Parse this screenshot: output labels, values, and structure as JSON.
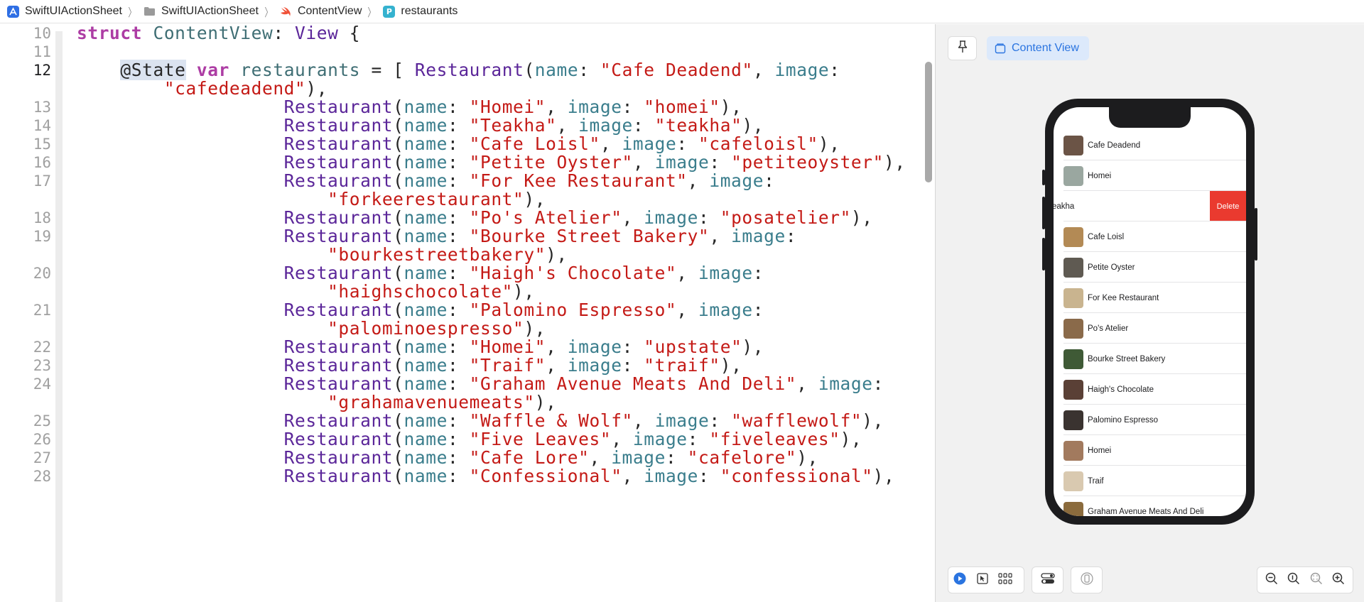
{
  "breadcrumb": [
    {
      "label": "SwiftUIActionSheet",
      "icon": "xcode-project-icon"
    },
    {
      "label": "SwiftUIActionSheet",
      "icon": "folder-icon"
    },
    {
      "label": "ContentView",
      "icon": "swift-file-icon"
    },
    {
      "label": "restaurants",
      "icon": "property-icon"
    }
  ],
  "property_badge": "P",
  "code_lines": [
    {
      "n": "10",
      "html_key": 0
    },
    {
      "n": "11",
      "html_key": 1
    },
    {
      "n": "12",
      "html_key": 2
    },
    {
      "n": "",
      "html_key": 3
    },
    {
      "n": "13",
      "html_key": 4
    },
    {
      "n": "14",
      "html_key": 5
    },
    {
      "n": "15",
      "html_key": 6
    },
    {
      "n": "16",
      "html_key": 7
    },
    {
      "n": "17",
      "html_key": 8
    },
    {
      "n": "",
      "html_key": 9
    },
    {
      "n": "18",
      "html_key": 10
    },
    {
      "n": "19",
      "html_key": 11
    },
    {
      "n": "",
      "html_key": 12
    },
    {
      "n": "20",
      "html_key": 13
    },
    {
      "n": "",
      "html_key": 14
    },
    {
      "n": "21",
      "html_key": 15
    },
    {
      "n": "",
      "html_key": 16
    },
    {
      "n": "22",
      "html_key": 17
    },
    {
      "n": "23",
      "html_key": 18
    },
    {
      "n": "24",
      "html_key": 19
    },
    {
      "n": "",
      "html_key": 20
    },
    {
      "n": "25",
      "html_key": 21
    },
    {
      "n": "26",
      "html_key": 22
    },
    {
      "n": "27",
      "html_key": 23
    },
    {
      "n": "28",
      "html_key": 24
    }
  ],
  "tokens": [
    [
      [
        "kw",
        "struct"
      ],
      [
        "p",
        " "
      ],
      [
        "ty2",
        "ContentView"
      ],
      [
        "p",
        ": "
      ],
      [
        "ty",
        "View"
      ],
      [
        "p",
        " {"
      ]
    ],
    [],
    [
      [
        "p",
        "    "
      ],
      [
        "hl",
        "@State"
      ],
      [
        "p",
        " "
      ],
      [
        "kw",
        "var"
      ],
      [
        "p",
        " "
      ],
      [
        "ty2",
        "restaurants"
      ],
      [
        "p",
        " = [ "
      ],
      [
        "ty",
        "Restaurant"
      ],
      [
        "p",
        "("
      ],
      [
        "param",
        "name"
      ],
      [
        "p",
        ": "
      ],
      [
        "str",
        "\"Cafe Deadend\""
      ],
      [
        "p",
        ", "
      ],
      [
        "param",
        "image"
      ],
      [
        "p",
        ":"
      ]
    ],
    [
      [
        "p",
        "        "
      ],
      [
        "str",
        "\"cafedeadend\""
      ],
      [
        "p",
        "),"
      ]
    ],
    [
      [
        "p",
        "                   "
      ],
      [
        "ty",
        "Restaurant"
      ],
      [
        "p",
        "("
      ],
      [
        "param",
        "name"
      ],
      [
        "p",
        ": "
      ],
      [
        "str",
        "\"Homei\""
      ],
      [
        "p",
        ", "
      ],
      [
        "param",
        "image"
      ],
      [
        "p",
        ": "
      ],
      [
        "str",
        "\"homei\""
      ],
      [
        "p",
        "),"
      ]
    ],
    [
      [
        "p",
        "                   "
      ],
      [
        "ty",
        "Restaurant"
      ],
      [
        "p",
        "("
      ],
      [
        "param",
        "name"
      ],
      [
        "p",
        ": "
      ],
      [
        "str",
        "\"Teakha\""
      ],
      [
        "p",
        ", "
      ],
      [
        "param",
        "image"
      ],
      [
        "p",
        ": "
      ],
      [
        "str",
        "\"teakha\""
      ],
      [
        "p",
        "),"
      ]
    ],
    [
      [
        "p",
        "                   "
      ],
      [
        "ty",
        "Restaurant"
      ],
      [
        "p",
        "("
      ],
      [
        "param",
        "name"
      ],
      [
        "p",
        ": "
      ],
      [
        "str",
        "\"Cafe Loisl\""
      ],
      [
        "p",
        ", "
      ],
      [
        "param",
        "image"
      ],
      [
        "p",
        ": "
      ],
      [
        "str",
        "\"cafeloisl\""
      ],
      [
        "p",
        "),"
      ]
    ],
    [
      [
        "p",
        "                   "
      ],
      [
        "ty",
        "Restaurant"
      ],
      [
        "p",
        "("
      ],
      [
        "param",
        "name"
      ],
      [
        "p",
        ": "
      ],
      [
        "str",
        "\"Petite Oyster\""
      ],
      [
        "p",
        ", "
      ],
      [
        "param",
        "image"
      ],
      [
        "p",
        ": "
      ],
      [
        "str",
        "\"petiteoyster\""
      ],
      [
        "p",
        "),"
      ]
    ],
    [
      [
        "p",
        "                   "
      ],
      [
        "ty",
        "Restaurant"
      ],
      [
        "p",
        "("
      ],
      [
        "param",
        "name"
      ],
      [
        "p",
        ": "
      ],
      [
        "str",
        "\"For Kee Restaurant\""
      ],
      [
        "p",
        ", "
      ],
      [
        "param",
        "image"
      ],
      [
        "p",
        ":"
      ]
    ],
    [
      [
        "p",
        "                       "
      ],
      [
        "str",
        "\"forkeerestaurant\""
      ],
      [
        "p",
        "),"
      ]
    ],
    [
      [
        "p",
        "                   "
      ],
      [
        "ty",
        "Restaurant"
      ],
      [
        "p",
        "("
      ],
      [
        "param",
        "name"
      ],
      [
        "p",
        ": "
      ],
      [
        "str",
        "\"Po's Atelier\""
      ],
      [
        "p",
        ", "
      ],
      [
        "param",
        "image"
      ],
      [
        "p",
        ": "
      ],
      [
        "str",
        "\"posatelier\""
      ],
      [
        "p",
        "),"
      ]
    ],
    [
      [
        "p",
        "                   "
      ],
      [
        "ty",
        "Restaurant"
      ],
      [
        "p",
        "("
      ],
      [
        "param",
        "name"
      ],
      [
        "p",
        ": "
      ],
      [
        "str",
        "\"Bourke Street Bakery\""
      ],
      [
        "p",
        ", "
      ],
      [
        "param",
        "image"
      ],
      [
        "p",
        ":"
      ]
    ],
    [
      [
        "p",
        "                       "
      ],
      [
        "str",
        "\"bourkestreetbakery\""
      ],
      [
        "p",
        "),"
      ]
    ],
    [
      [
        "p",
        "                   "
      ],
      [
        "ty",
        "Restaurant"
      ],
      [
        "p",
        "("
      ],
      [
        "param",
        "name"
      ],
      [
        "p",
        ": "
      ],
      [
        "str",
        "\"Haigh's Chocolate\""
      ],
      [
        "p",
        ", "
      ],
      [
        "param",
        "image"
      ],
      [
        "p",
        ":"
      ]
    ],
    [
      [
        "p",
        "                       "
      ],
      [
        "str",
        "\"haighschocolate\""
      ],
      [
        "p",
        "),"
      ]
    ],
    [
      [
        "p",
        "                   "
      ],
      [
        "ty",
        "Restaurant"
      ],
      [
        "p",
        "("
      ],
      [
        "param",
        "name"
      ],
      [
        "p",
        ": "
      ],
      [
        "str",
        "\"Palomino Espresso\""
      ],
      [
        "p",
        ", "
      ],
      [
        "param",
        "image"
      ],
      [
        "p",
        ":"
      ]
    ],
    [
      [
        "p",
        "                       "
      ],
      [
        "str",
        "\"palominoespresso\""
      ],
      [
        "p",
        "),"
      ]
    ],
    [
      [
        "p",
        "                   "
      ],
      [
        "ty",
        "Restaurant"
      ],
      [
        "p",
        "("
      ],
      [
        "param",
        "name"
      ],
      [
        "p",
        ": "
      ],
      [
        "str",
        "\"Homei\""
      ],
      [
        "p",
        ", "
      ],
      [
        "param",
        "image"
      ],
      [
        "p",
        ": "
      ],
      [
        "str",
        "\"upstate\""
      ],
      [
        "p",
        "),"
      ]
    ],
    [
      [
        "p",
        "                   "
      ],
      [
        "ty",
        "Restaurant"
      ],
      [
        "p",
        "("
      ],
      [
        "param",
        "name"
      ],
      [
        "p",
        ": "
      ],
      [
        "str",
        "\"Traif\""
      ],
      [
        "p",
        ", "
      ],
      [
        "param",
        "image"
      ],
      [
        "p",
        ": "
      ],
      [
        "str",
        "\"traif\""
      ],
      [
        "p",
        "),"
      ]
    ],
    [
      [
        "p",
        "                   "
      ],
      [
        "ty",
        "Restaurant"
      ],
      [
        "p",
        "("
      ],
      [
        "param",
        "name"
      ],
      [
        "p",
        ": "
      ],
      [
        "str",
        "\"Graham Avenue Meats And Deli\""
      ],
      [
        "p",
        ", "
      ],
      [
        "param",
        "image"
      ],
      [
        "p",
        ":"
      ]
    ],
    [
      [
        "p",
        "                       "
      ],
      [
        "str",
        "\"grahamavenuemeats\""
      ],
      [
        "p",
        "),"
      ]
    ],
    [
      [
        "p",
        "                   "
      ],
      [
        "ty",
        "Restaurant"
      ],
      [
        "p",
        "("
      ],
      [
        "param",
        "name"
      ],
      [
        "p",
        ": "
      ],
      [
        "str",
        "\"Waffle & Wolf\""
      ],
      [
        "p",
        ", "
      ],
      [
        "param",
        "image"
      ],
      [
        "p",
        ": "
      ],
      [
        "str",
        "\"wafflewolf\""
      ],
      [
        "p",
        "),"
      ]
    ],
    [
      [
        "p",
        "                   "
      ],
      [
        "ty",
        "Restaurant"
      ],
      [
        "p",
        "("
      ],
      [
        "param",
        "name"
      ],
      [
        "p",
        ": "
      ],
      [
        "str",
        "\"Five Leaves\""
      ],
      [
        "p",
        ", "
      ],
      [
        "param",
        "image"
      ],
      [
        "p",
        ": "
      ],
      [
        "str",
        "\"fiveleaves\""
      ],
      [
        "p",
        "),"
      ]
    ],
    [
      [
        "p",
        "                   "
      ],
      [
        "ty",
        "Restaurant"
      ],
      [
        "p",
        "("
      ],
      [
        "param",
        "name"
      ],
      [
        "p",
        ": "
      ],
      [
        "str",
        "\"Cafe Lore\""
      ],
      [
        "p",
        ", "
      ],
      [
        "param",
        "image"
      ],
      [
        "p",
        ": "
      ],
      [
        "str",
        "\"cafelore\""
      ],
      [
        "p",
        "),"
      ]
    ],
    [
      [
        "p",
        "                   "
      ],
      [
        "ty",
        "Restaurant"
      ],
      [
        "p",
        "("
      ],
      [
        "param",
        "name"
      ],
      [
        "p",
        ": "
      ],
      [
        "str",
        "\"Confessional\""
      ],
      [
        "p",
        ", "
      ],
      [
        "param",
        "image"
      ],
      [
        "p",
        ": "
      ],
      [
        "str",
        "\"confessional\""
      ],
      [
        "p",
        "),"
      ]
    ]
  ],
  "current_line": "12",
  "preview": {
    "content_view_label": "Content View",
    "delete_label": "Delete",
    "swiped_row_label": "eakha",
    "rows": [
      {
        "name": "Cafe Deadend",
        "color": "#6b5446"
      },
      {
        "name": "Homei",
        "color": "#9aa7a0"
      },
      {
        "name": "eakha",
        "swiped": true
      },
      {
        "name": "Cafe Loisl",
        "color": "#b38a55"
      },
      {
        "name": "Petite Oyster",
        "color": "#5f5a52"
      },
      {
        "name": "For Kee Restaurant",
        "color": "#c9b48f"
      },
      {
        "name": "Po's Atelier",
        "color": "#8a6a4a"
      },
      {
        "name": "Bourke Street Bakery",
        "color": "#3f5a36"
      },
      {
        "name": "Haigh's Chocolate",
        "color": "#5a4036"
      },
      {
        "name": "Palomino Espresso",
        "color": "#3a3330"
      },
      {
        "name": "Homei",
        "color": "#a27a5e"
      },
      {
        "name": "Traif",
        "color": "#d9c9b0"
      },
      {
        "name": "Graham Avenue Meats And Deli",
        "color": "#8b6b3d"
      }
    ]
  },
  "colors": {
    "accent": "#2a74e0",
    "delete": "#ea3a2f",
    "keyword": "#ad3da4",
    "string": "#c41a16"
  }
}
